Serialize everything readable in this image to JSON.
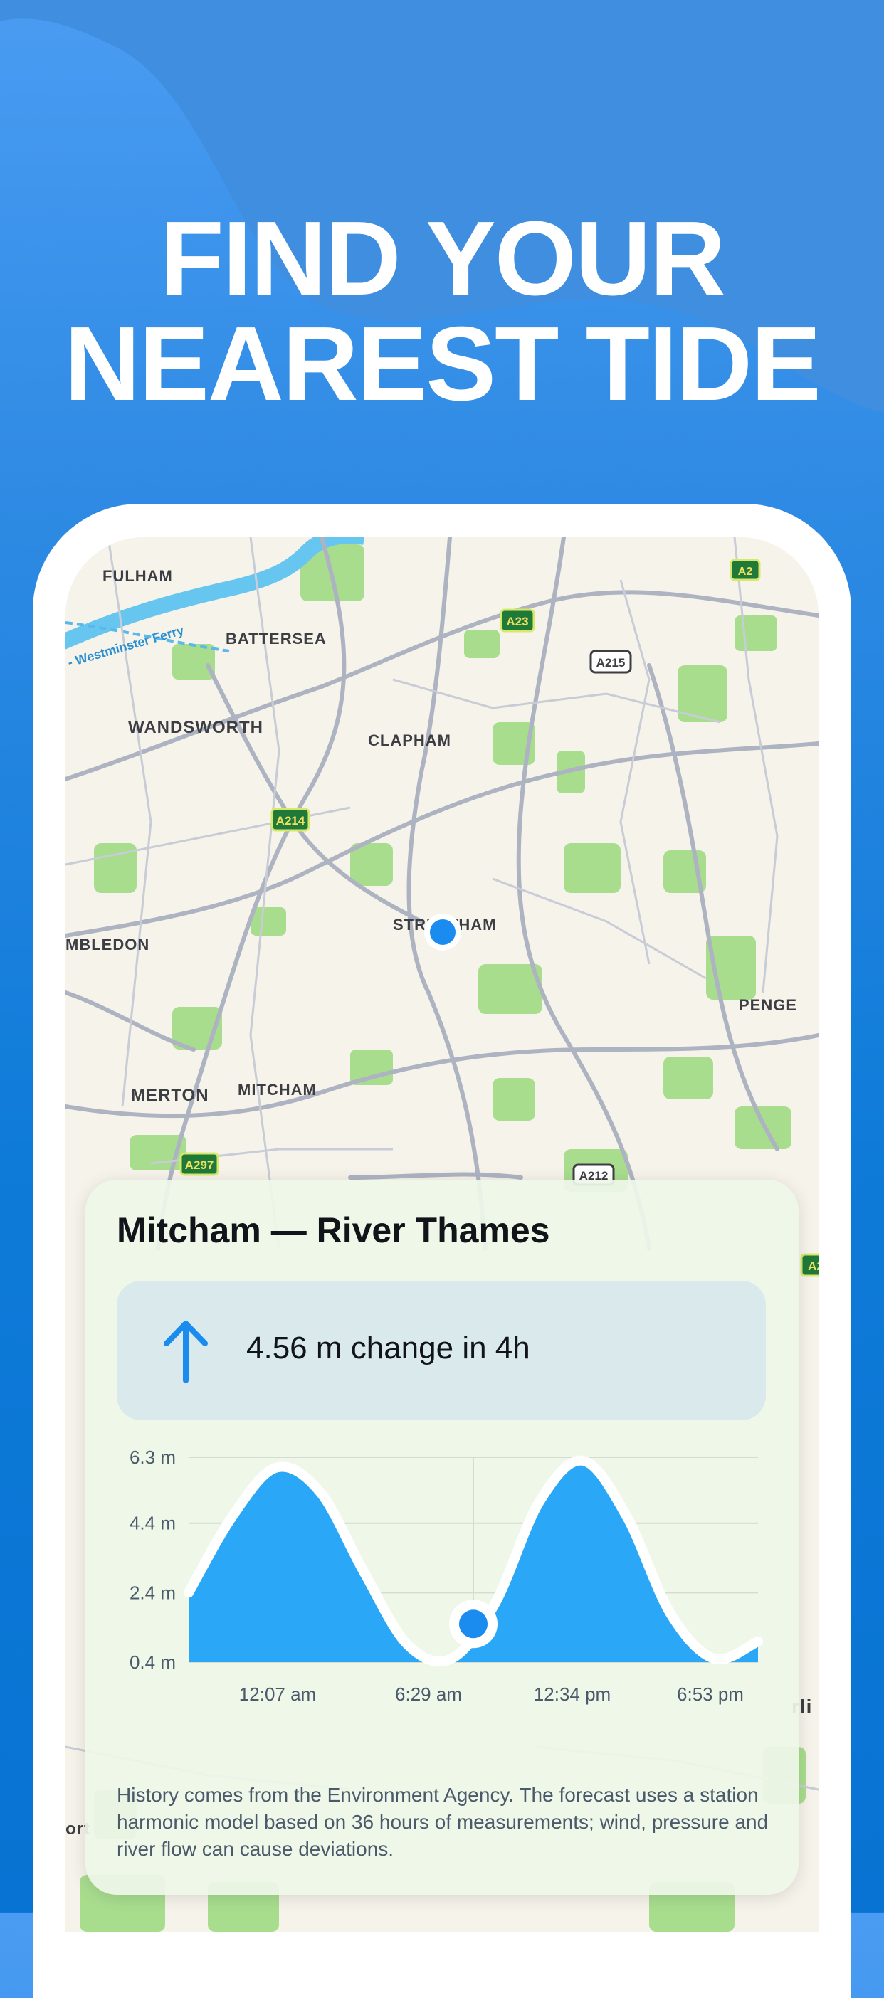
{
  "headline": {
    "line1": "FIND YOUR",
    "line2": "NEAREST TIDE"
  },
  "colors": {
    "background_top": "#4a9cf2",
    "background_bottom": "#0873d2",
    "wave": "#3f8ee0",
    "tide_fill": "#2aa7f6",
    "tide_line": "#ffffff",
    "marker": "#1a8cf0",
    "text_dark": "#111418",
    "arrow": "#1a8cf0"
  },
  "map": {
    "place_labels": [
      "FULHAM",
      "BATTERSEA",
      "WANDSWORTH",
      "CLAPHAM",
      "STREATHAM",
      "MBLEDON",
      "PENGE",
      "MERTON",
      "MITCHAM",
      "rli",
      "ort"
    ],
    "road_labels": [
      "A2",
      "A23",
      "A215",
      "A214",
      "A297",
      "A212",
      "A2"
    ],
    "river_label": "- Westminster Ferry",
    "location_marker": "current-location-dot"
  },
  "card": {
    "title": "Mitcham — River Thames",
    "change": {
      "icon": "arrow-up-icon",
      "text": "4.56 m change in 4h"
    },
    "footnote": "History comes from the Environment Agency. The forecast uses a station harmonic model based on 36 hours of measurements; wind, pressure and river flow can cause deviations."
  },
  "chart_data": {
    "type": "area",
    "title": "",
    "xlabel": "",
    "ylabel": "",
    "y_ticks": [
      "6.3 m",
      "4.4 m",
      "2.4 m",
      "0.4 m"
    ],
    "y_tick_values": [
      6.3,
      4.4,
      2.4,
      0.4
    ],
    "ylim": [
      0.4,
      6.3
    ],
    "x_ticks": [
      "12:07 am",
      "6:29 am",
      "12:34 pm",
      "6:53 pm"
    ],
    "x_hours": [
      0.0,
      2.0,
      4.0,
      6.0,
      8.0,
      10.0,
      12.0,
      14.0,
      16.0,
      18.0,
      20.0,
      22.0,
      24.0
    ],
    "x_hours_start_label": "12:07 am",
    "series": [
      {
        "values": [
          2.4,
          4.6,
          6.0,
          5.3,
          3.0,
          0.9,
          0.5,
          2.1,
          5.0,
          6.2,
          4.6,
          1.8,
          0.5,
          1.0
        ]
      }
    ],
    "current_point": {
      "x_label": "6:29 am",
      "value": 1.5
    },
    "grid": true
  }
}
